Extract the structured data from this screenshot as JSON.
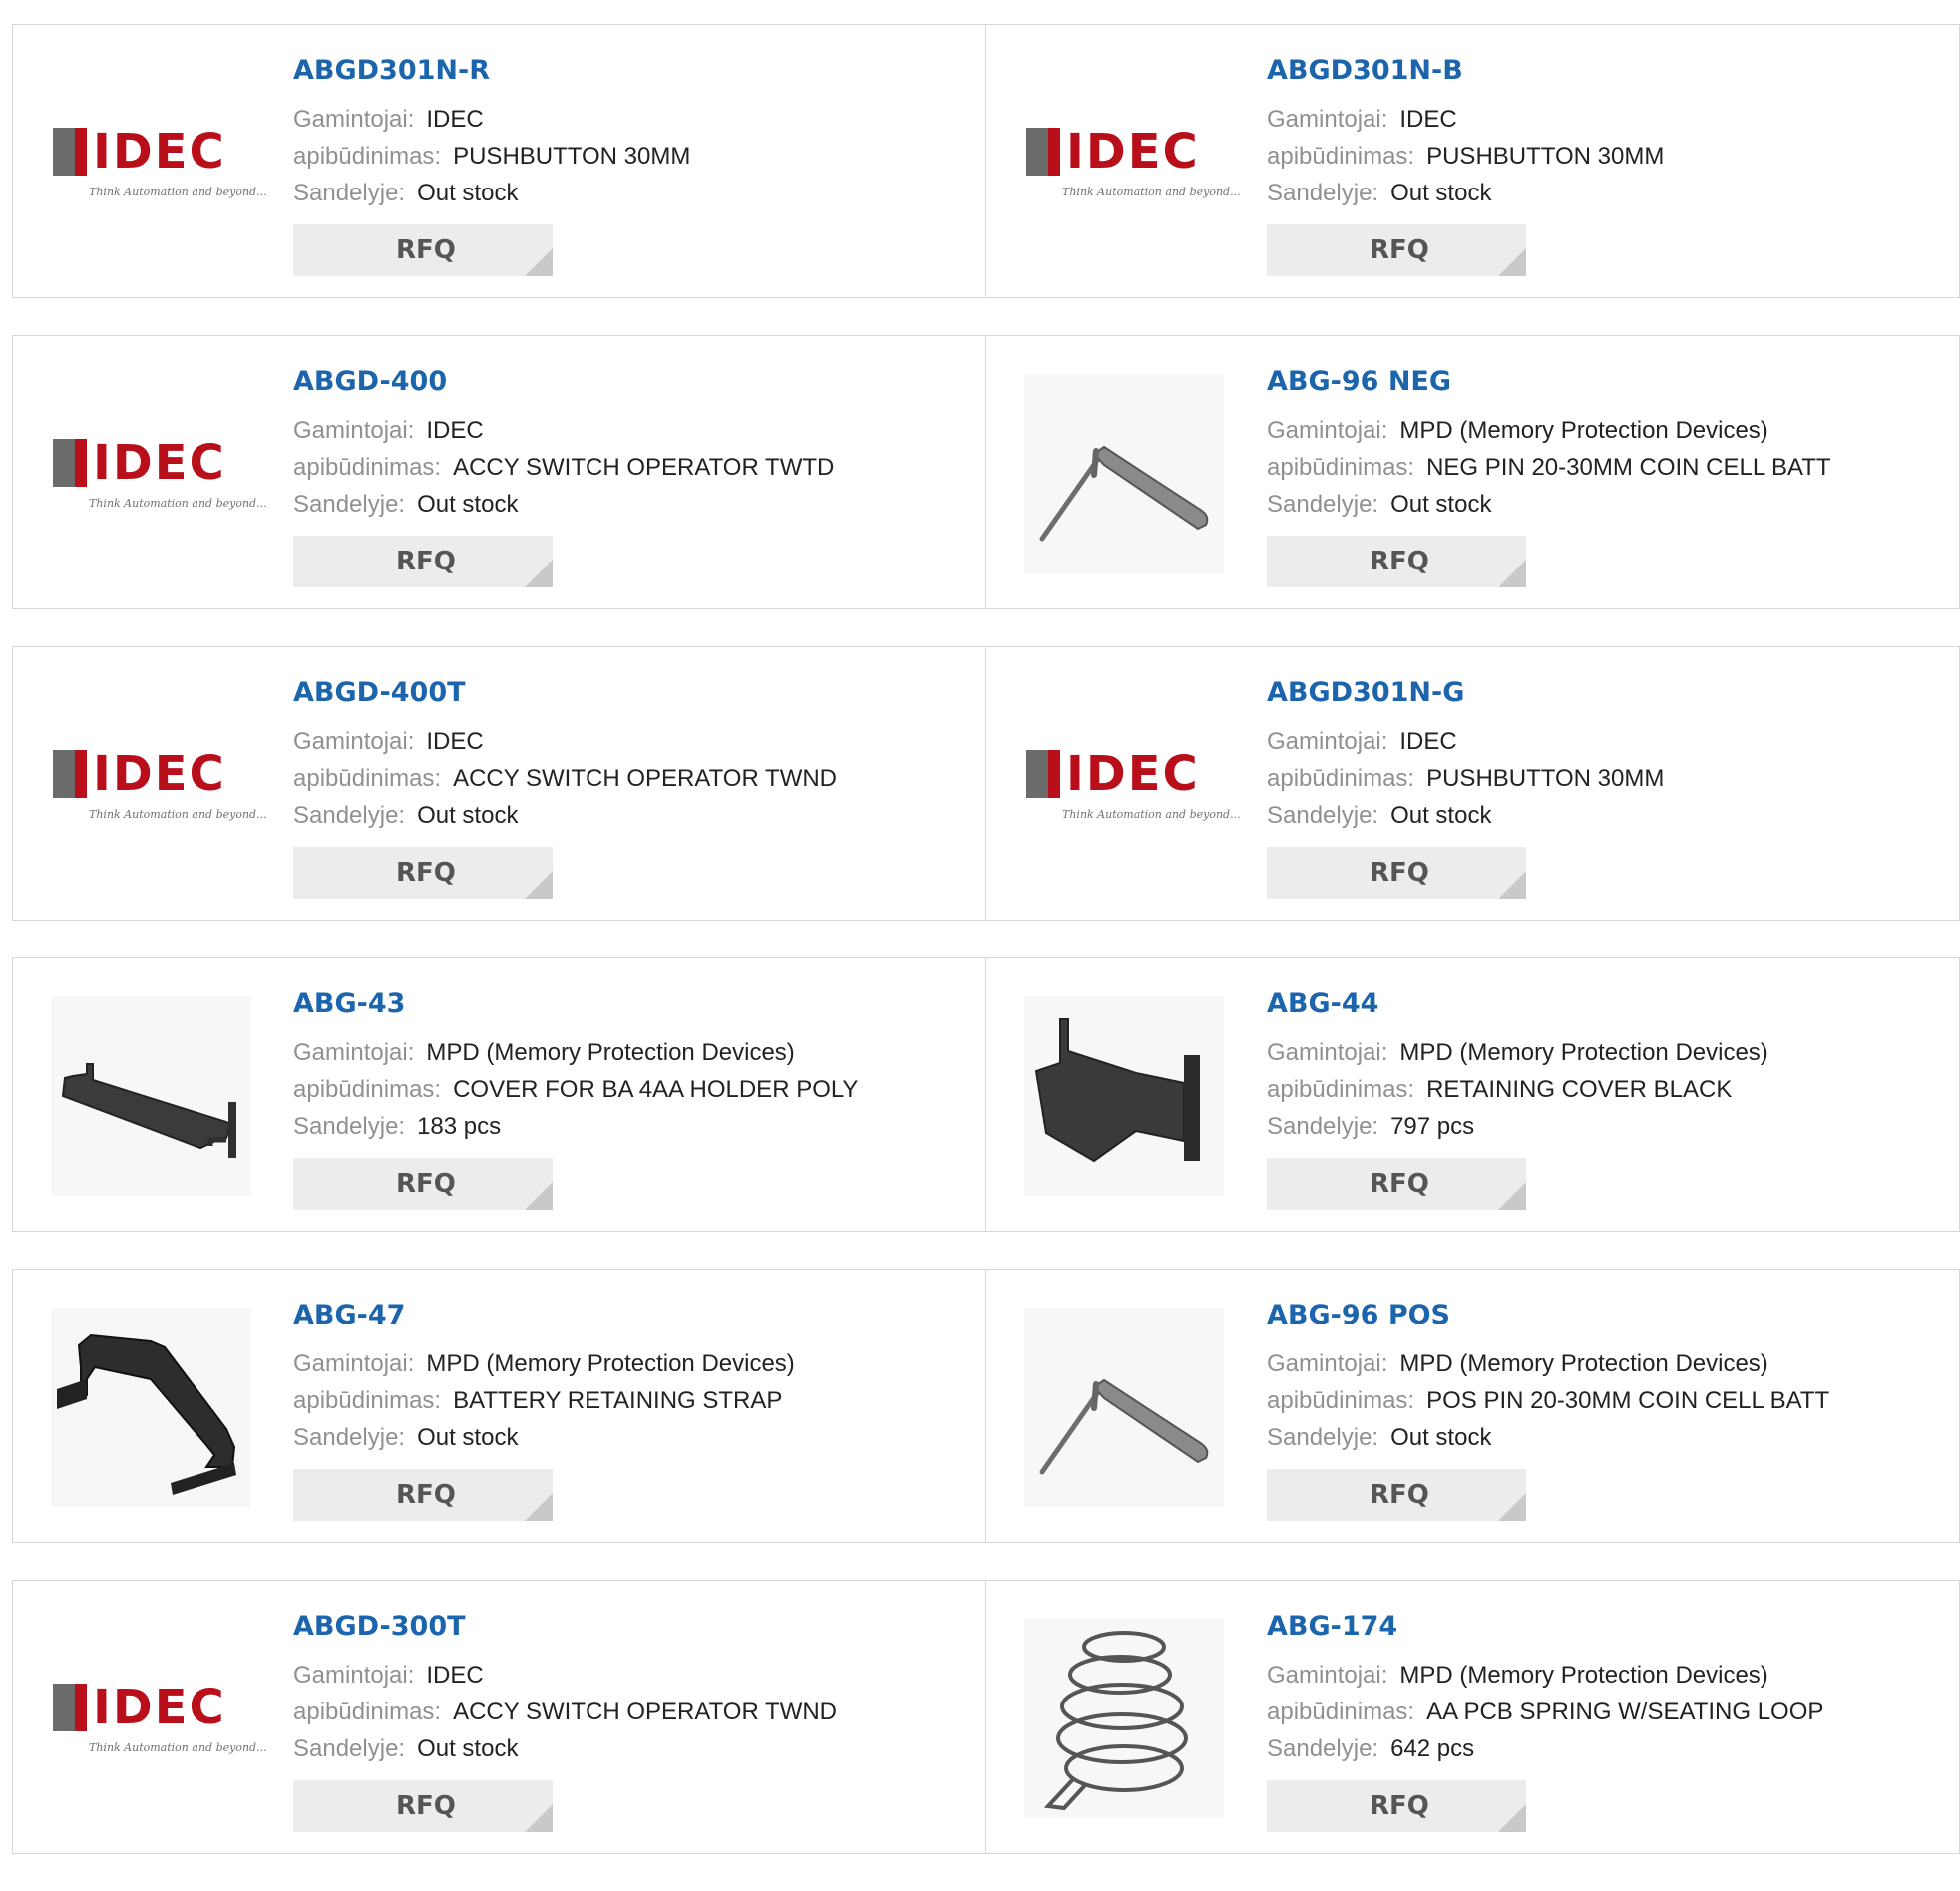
{
  "labels": {
    "manufacturer": "Gamintojai:",
    "description": "apibūdinimas:",
    "stock": "Sandelyje:",
    "rfq": "RFQ"
  },
  "logo": {
    "text": "IDEC",
    "tagline": "Think Automation and beyond..."
  },
  "products": [
    {
      "part": "ABGD301N-R",
      "manufacturer": "IDEC",
      "description": "PUSHBUTTON 30MM",
      "stock": "Out stock",
      "image": "idec-logo"
    },
    {
      "part": "ABGD301N-B",
      "manufacturer": "IDEC",
      "description": "PUSHBUTTON 30MM",
      "stock": "Out stock",
      "image": "idec-logo"
    },
    {
      "part": "ABGD-400",
      "manufacturer": "IDEC",
      "description": "ACCY SWITCH OPERATOR TWTD",
      "stock": "Out stock",
      "image": "idec-logo"
    },
    {
      "part": "ABG-96 NEG",
      "manufacturer": "MPD (Memory Protection Devices)",
      "description": "NEG PIN 20-30MM COIN CELL BATT",
      "stock": "Out stock",
      "image": "pin-photo"
    },
    {
      "part": "ABGD-400T",
      "manufacturer": "IDEC",
      "description": "ACCY SWITCH OPERATOR TWND",
      "stock": "Out stock",
      "image": "idec-logo"
    },
    {
      "part": "ABGD301N-G",
      "manufacturer": "IDEC",
      "description": "PUSHBUTTON 30MM",
      "stock": "Out stock",
      "image": "idec-logo"
    },
    {
      "part": "ABG-43",
      "manufacturer": "MPD (Memory Protection Devices)",
      "description": "COVER FOR BA 4AA HOLDER POLY",
      "stock": "183 pcs",
      "image": "cover-photo"
    },
    {
      "part": "ABG-44",
      "manufacturer": "MPD (Memory Protection Devices)",
      "description": "RETAINING COVER BLACK",
      "stock": "797 pcs",
      "image": "retaining-cover-photo"
    },
    {
      "part": "ABG-47",
      "manufacturer": "MPD (Memory Protection Devices)",
      "description": "BATTERY RETAINING STRAP",
      "stock": "Out stock",
      "image": "strap-photo"
    },
    {
      "part": "ABG-96 POS",
      "manufacturer": "MPD (Memory Protection Devices)",
      "description": "POS PIN 20-30MM COIN CELL BATT",
      "stock": "Out stock",
      "image": "pin-photo"
    },
    {
      "part": "ABGD-300T",
      "manufacturer": "IDEC",
      "description": "ACCY SWITCH OPERATOR TWND",
      "stock": "Out stock",
      "image": "idec-logo"
    },
    {
      "part": "ABG-174",
      "manufacturer": "MPD (Memory Protection Devices)",
      "description": "AA PCB SPRING W/SEATING LOOP",
      "stock": "642 pcs",
      "image": "spring-photo"
    }
  ]
}
